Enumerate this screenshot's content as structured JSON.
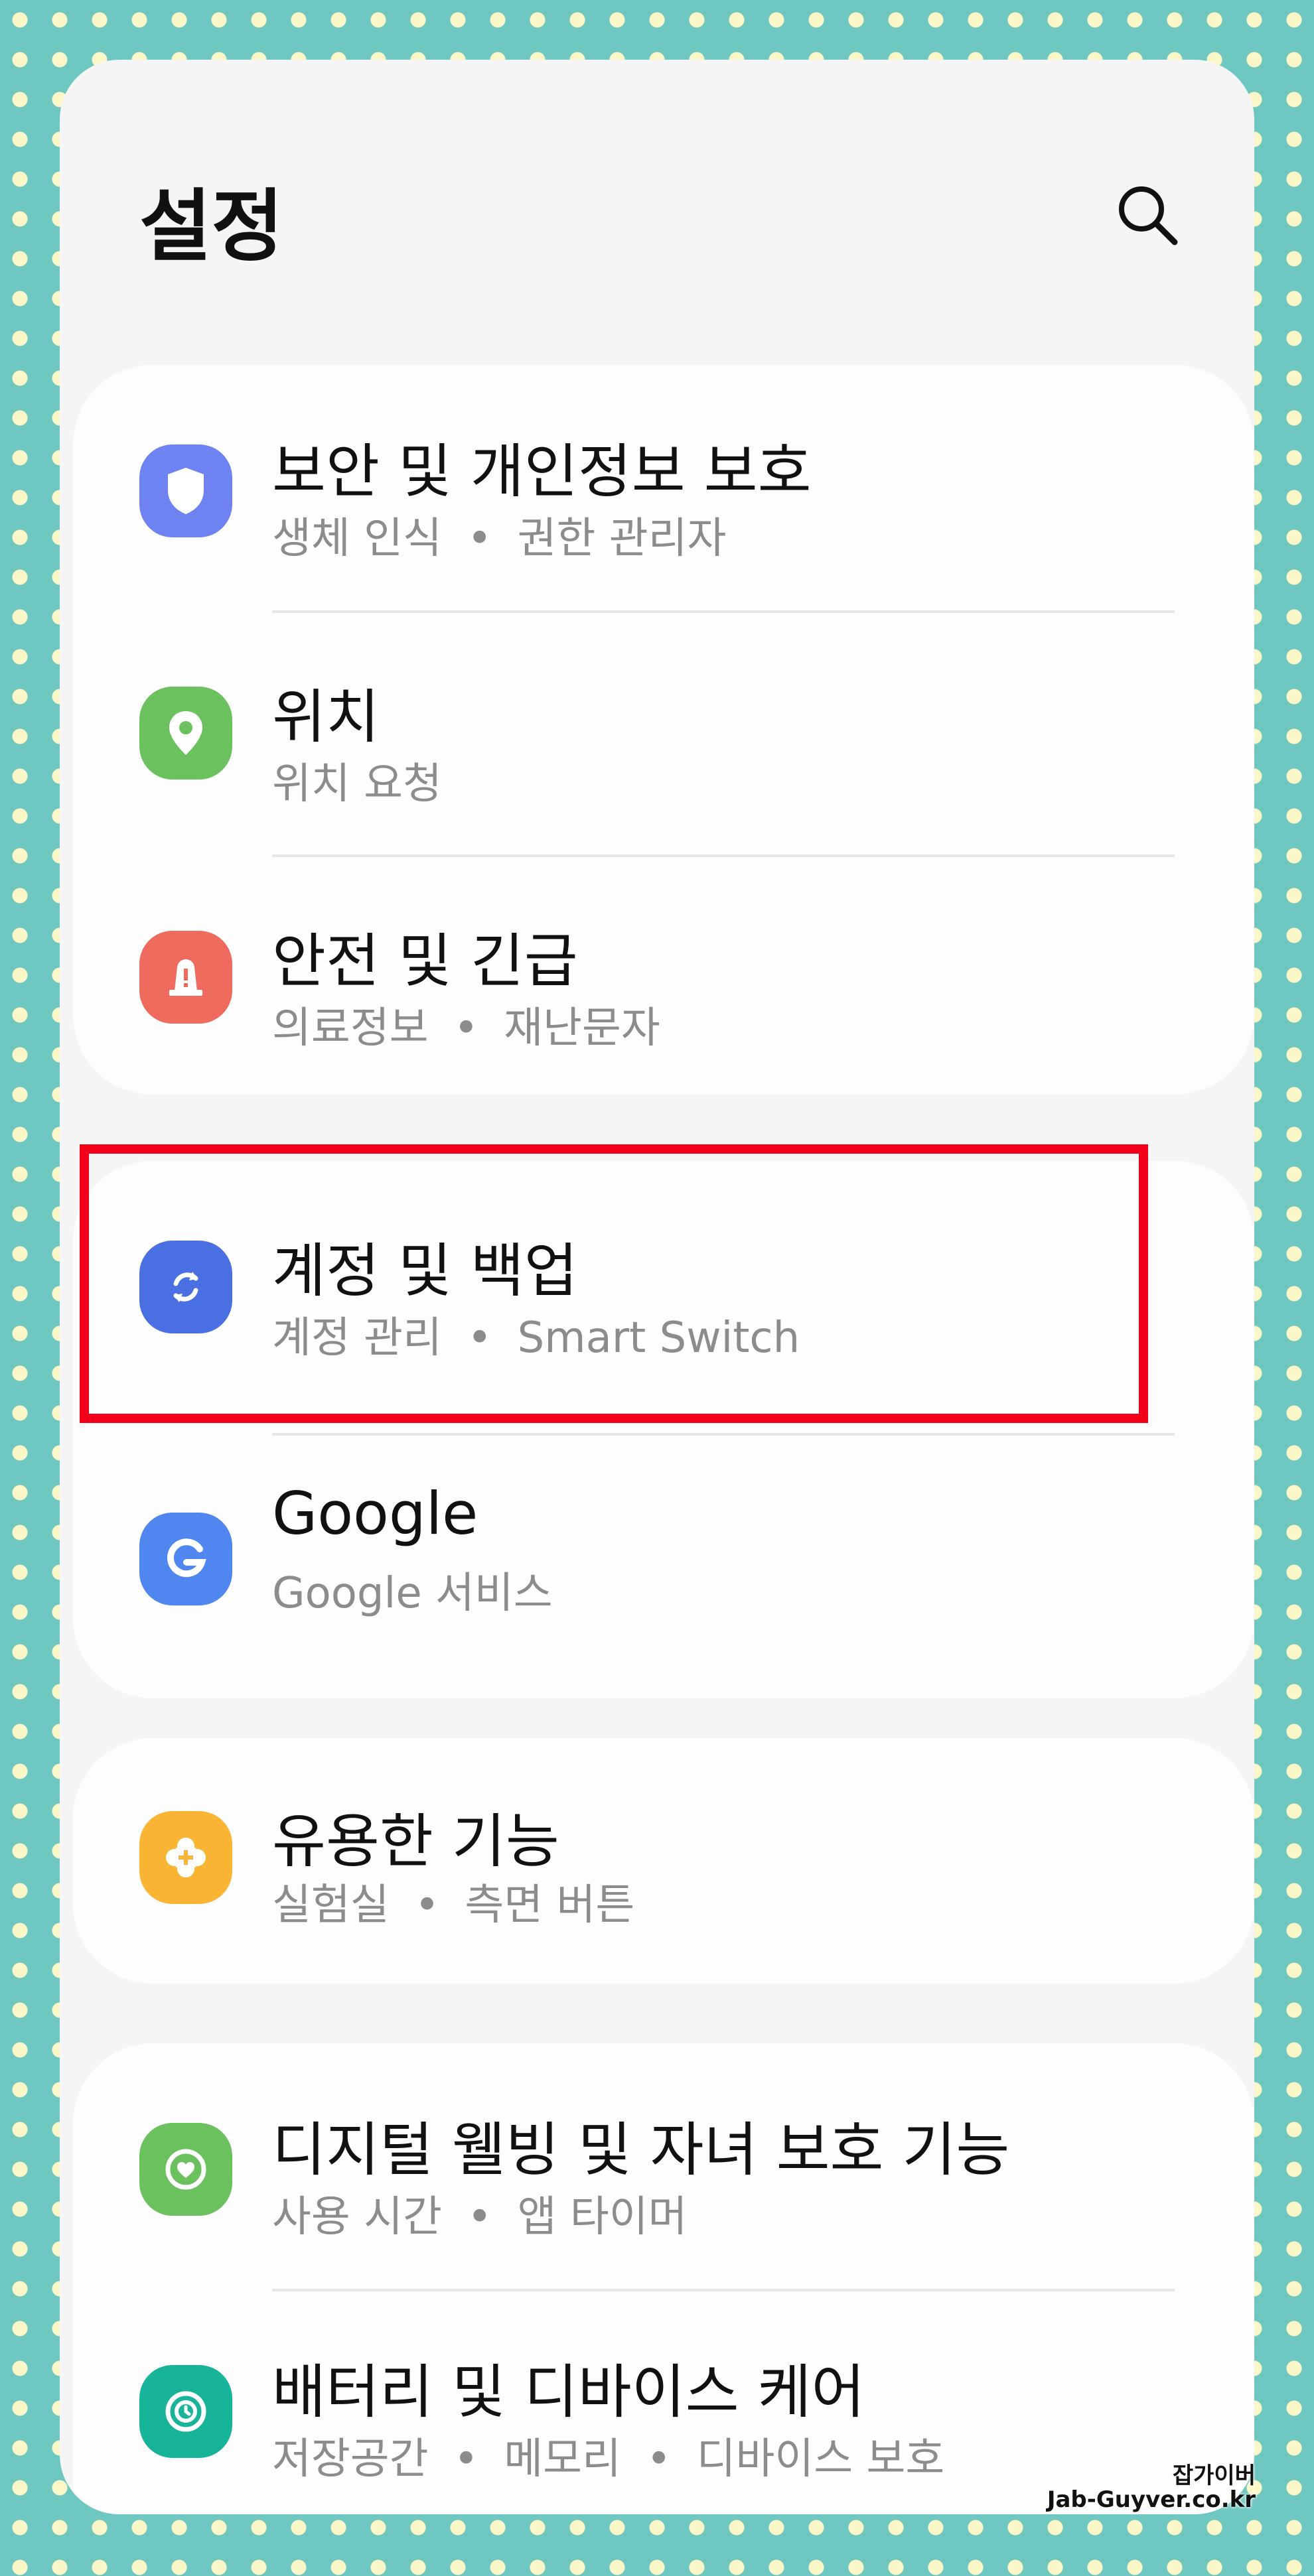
{
  "header": {
    "title": "설정"
  },
  "items": [
    {
      "title": "보안 및 개인정보 보호",
      "subs": [
        "생체 인식",
        "권한 관리자"
      ],
      "icon": "shield-icon",
      "color": "#6f82f2"
    },
    {
      "title": "위치",
      "subs": [
        "위치 요청"
      ],
      "icon": "location-pin-icon",
      "color": "#6cc15f"
    },
    {
      "title": "안전 및 긴급",
      "subs": [
        "의료정보",
        "재난문자"
      ],
      "icon": "emergency-siren-icon",
      "color": "#ee6b5e"
    },
    {
      "title": "계정 및 백업",
      "subs": [
        "계정 관리",
        "Smart Switch"
      ],
      "icon": "sync-icon",
      "color": "#4a6fe2"
    },
    {
      "title": "Google",
      "subs": [
        "Google 서비스"
      ],
      "icon": "google-icon",
      "color": "#4f86f0"
    },
    {
      "title": "유용한 기능",
      "subs": [
        "실험실",
        "측면 버튼"
      ],
      "icon": "puzzle-plus-icon",
      "color": "#f8b432"
    },
    {
      "title": "디지털 웰빙 및 자녀 보호 기능",
      "subs": [
        "사용 시간",
        "앱 타이머"
      ],
      "icon": "wellbeing-heart-icon",
      "color": "#6cc15f"
    },
    {
      "title": "배터리 및 디바이스 케어",
      "subs": [
        "저장공간",
        "메모리",
        "디바이스 보호"
      ],
      "icon": "device-care-icon",
      "color": "#18b49a"
    }
  ],
  "watermark": {
    "line1": "잡가이버",
    "line2": "Jab-Guyver.co.kr"
  }
}
